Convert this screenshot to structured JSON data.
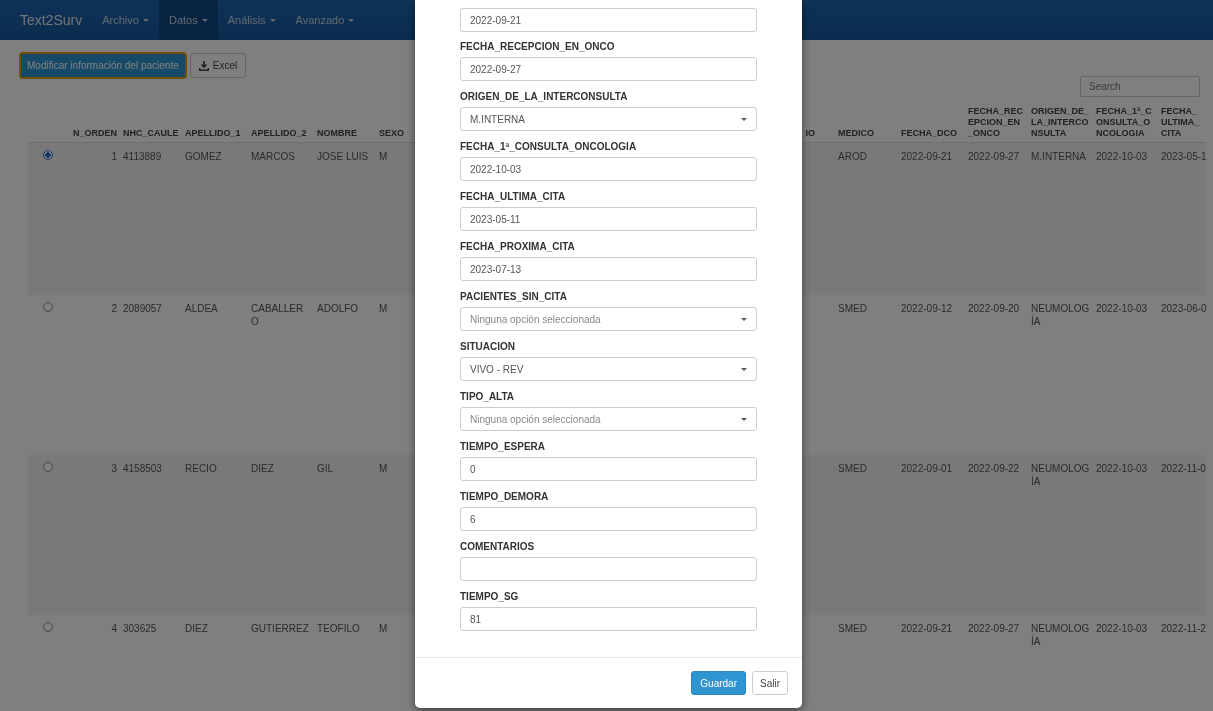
{
  "navbar": {
    "brand": "Text2Surv",
    "menus": [
      {
        "label": "Archivo",
        "selected": false
      },
      {
        "label": "Datos",
        "selected": true
      },
      {
        "label": "Análisis",
        "selected": false
      },
      {
        "label": "Avanzado",
        "selected": false
      }
    ]
  },
  "toolbar": {
    "edit_button": "Modificar información del paciente",
    "excel_button": "Excel"
  },
  "search": {
    "placeholder": "Search"
  },
  "table": {
    "left_columns": [
      "N_ORDEN",
      "NHC_CAULE",
      "APELLIDO_1",
      "APELLIDO_2",
      "NOMBRE",
      "SEXO"
    ],
    "partial_column": "IO",
    "right_columns": [
      "MEDICO",
      "FECHA_DCO",
      "FECHA_RECEPCION_EN_ONCO",
      "ORIGEN_DE_LA_INTERCONSULTA",
      "FECHA_1ª_CONSULTA_ONCOLOGIA",
      "FECHA_ULTIMA_CITA"
    ],
    "rows": [
      {
        "selected": true,
        "left_cells": [
          "1",
          "4113889",
          "GOMEZ",
          "MARCOS",
          "JOSE LUIS",
          "M"
        ],
        "right_cells": [
          "AROD",
          "2022-09-21",
          "2022-09-27",
          "M.INTERNA",
          "2022-10-03",
          "2023-05-1"
        ]
      },
      {
        "selected": false,
        "left_cells": [
          "2",
          "2089057",
          "ALDEA",
          "CABALLERO",
          "ADOLFO",
          "M"
        ],
        "right_cells": [
          "SMED",
          "2022-09-12",
          "2022-09-20",
          "NEUMOLOGÍA",
          "2022-10-03",
          "2023-06-0"
        ]
      },
      {
        "selected": false,
        "left_cells": [
          "3",
          "4158503",
          "RECIO",
          "DIEZ",
          "GIL",
          "M"
        ],
        "right_cells": [
          "SMED",
          "2022-09-01",
          "2022-09-22",
          "NEUMOLOGÍA",
          "2022-10-03",
          "2022-11-0"
        ]
      },
      {
        "selected": false,
        "left_cells": [
          "4",
          "303625",
          "DIEZ",
          "GUTIERREZ",
          "TEOFILO",
          "M"
        ],
        "right_cells": [
          "SMED",
          "2022-09-21",
          "2022-09-27",
          "NEUMOLOGÍA",
          "2022-10-03",
          "2022-11-2"
        ]
      }
    ]
  },
  "modal": {
    "fields": [
      {
        "kind": "input",
        "value": "2022-09-21"
      },
      {
        "kind": "input",
        "label": "FECHA_RECEPCION_EN_ONCO",
        "value": "2022-09-27"
      },
      {
        "kind": "select",
        "label": "ORIGEN_DE_LA_INTERCONSULTA",
        "value": "M.INTERNA"
      },
      {
        "kind": "input",
        "label": "FECHA_1ª_CONSULTA_ONCOLOGIA",
        "value": "2022-10-03"
      },
      {
        "kind": "input",
        "label": "FECHA_ULTIMA_CITA",
        "value": "2023-05-11"
      },
      {
        "kind": "input",
        "label": "FECHA_PROXIMA_CITA",
        "value": "2023-07-13"
      },
      {
        "kind": "select",
        "label": "PACIENTES_SIN_CITA",
        "placeholder": "Ninguna opción seleccionada"
      },
      {
        "kind": "select",
        "label": "SITUACION",
        "value": "VIVO - REV"
      },
      {
        "kind": "select",
        "label": "TIPO_ALTA",
        "placeholder": "Ninguna opción seleccionada"
      },
      {
        "kind": "input",
        "label": "TIEMPO_ESPERA",
        "value": "0"
      },
      {
        "kind": "input",
        "label": "TIEMPO_DEMORA",
        "value": "6"
      },
      {
        "kind": "input",
        "label": "COMENTARIOS"
      },
      {
        "kind": "input",
        "label": "TIEMPO_SG",
        "value": "81"
      }
    ],
    "save_button": "Guardar",
    "exit_button": "Salir"
  }
}
